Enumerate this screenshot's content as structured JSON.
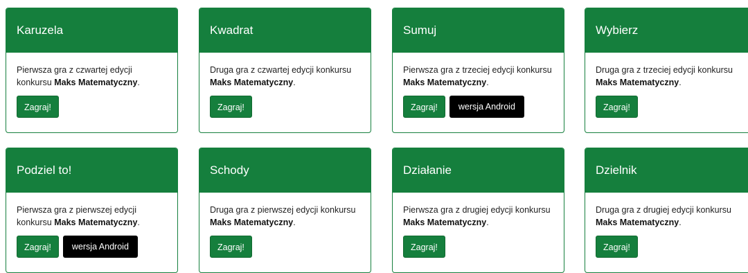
{
  "colors": {
    "primary": "#157f3d",
    "android": "#000000",
    "text": "#222222"
  },
  "games": [
    {
      "title": "Karuzela",
      "desc_prefix": "Pierwsza gra z czwartej edycji konkursu ",
      "contest": "Maks Matematyczny",
      "desc_suffix": ".",
      "play_label": "Zagraj!"
    },
    {
      "title": "Kwadrat",
      "desc_prefix": "Druga gra z czwartej edycji konkursu ",
      "contest": "Maks Matematyczny",
      "desc_suffix": ".",
      "play_label": "Zagraj!"
    },
    {
      "title": "Sumuj",
      "desc_prefix": "Pierwsza gra z trzeciej edycji konkursu ",
      "contest": "Maks Matematyczny",
      "desc_suffix": ".",
      "play_label": "Zagraj!",
      "android_label": "wersja Android"
    },
    {
      "title": "Wybierz",
      "desc_prefix": "Druga gra z trzeciej edycji konkursu ",
      "contest": "Maks Matematyczny",
      "desc_suffix": ".",
      "play_label": "Zagraj!"
    },
    {
      "title": "Podziel to!",
      "desc_prefix": "Pierwsza gra z pierwszej edycji konkursu ",
      "contest": "Maks Matematyczny",
      "desc_suffix": ".",
      "play_label": "Zagraj!",
      "android_label": "wersja Android"
    },
    {
      "title": "Schody",
      "desc_prefix": "Druga gra z pierwszej edycji konkursu ",
      "contest": "Maks Matematyczny",
      "desc_suffix": ".",
      "play_label": "Zagraj!"
    },
    {
      "title": "Działanie",
      "desc_prefix": "Pierwsza gra z drugiej edycji konkursu ",
      "contest": "Maks Matematyczny",
      "desc_suffix": ".",
      "play_label": "Zagraj!"
    },
    {
      "title": "Dzielnik",
      "desc_prefix": "Druga gra z drugiej edycji konkursu ",
      "contest": "Maks Matematyczny",
      "desc_suffix": ".",
      "play_label": "Zagraj!"
    }
  ]
}
